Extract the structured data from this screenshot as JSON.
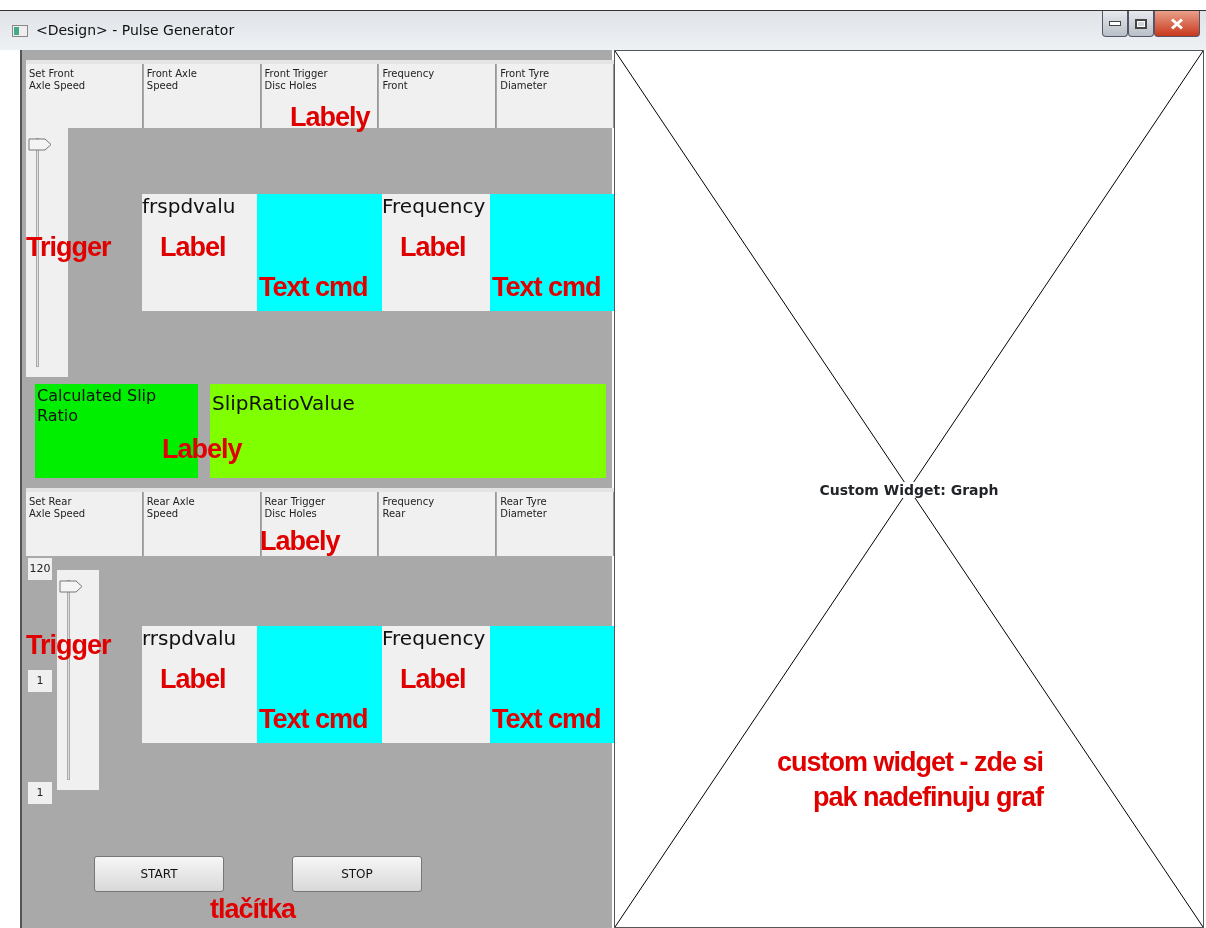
{
  "window": {
    "title": "<Design> - Pulse Generator"
  },
  "front": {
    "headers": [
      "Set Front\nAxle Speed",
      "Front Axle\nSpeed",
      "Front Trigger\nDisc Holes",
      "Frequency\nFront",
      "Front Tyre\nDiameter"
    ],
    "headers_note": "Labely",
    "slider": {
      "level": 1,
      "note": "Trigger"
    },
    "displays": [
      {
        "kind": "label",
        "text": "frspdvalu",
        "note": "Label"
      },
      {
        "kind": "textcmd",
        "note": "Text cmd"
      },
      {
        "kind": "label",
        "text": "Frequency",
        "note": "Label"
      },
      {
        "kind": "textcmd",
        "note": "Text cmd"
      }
    ]
  },
  "slip": {
    "caption": "Calculated Slip\nRatio",
    "value": "SlipRatioValue",
    "note": "Labely"
  },
  "rear": {
    "headers": [
      "Set Rear\nAxle Speed",
      "Rear Axle\nSpeed",
      "Rear Trigger\nDisc Holes",
      "Frequency\nRear",
      "Rear Tyre\nDiameter"
    ],
    "headers_note": "Labely",
    "slider": {
      "level": 1,
      "note": "Trigger",
      "scale": [
        "120",
        "1",
        "1"
      ]
    },
    "displays": [
      {
        "kind": "label",
        "text": "rrspdvalu",
        "note": "Label"
      },
      {
        "kind": "textcmd",
        "note": "Text cmd"
      },
      {
        "kind": "label",
        "text": "Frequency",
        "note": "Label"
      },
      {
        "kind": "textcmd",
        "note": "Text cmd"
      }
    ]
  },
  "buttons": [
    "START",
    "STOP"
  ],
  "buttons_note": "tlačítka",
  "graph": {
    "caption": "Custom Widget: Graph",
    "note": [
      "custom widget - zde si",
      "pak nadefinuju graf"
    ]
  }
}
